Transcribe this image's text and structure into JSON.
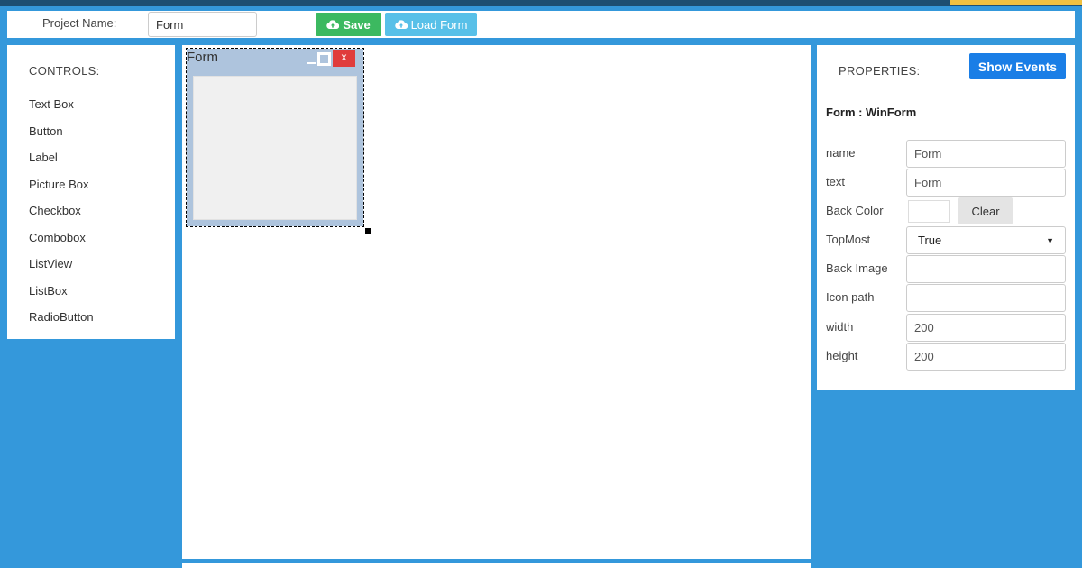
{
  "toolbar": {
    "project_name_label": "Project Name:",
    "project_name_value": "Form",
    "save_label": "Save",
    "load_label": "Load Form",
    "save_color": "#3cb960",
    "load_color": "#58c0e8"
  },
  "controls": {
    "title": "CONTROLS:",
    "items": [
      "Text Box",
      "Button",
      "Label",
      "Picture Box",
      "Checkbox",
      "Combobox",
      "ListView",
      "ListBox",
      "RadioButton"
    ]
  },
  "designer": {
    "form_title": "Form",
    "close_label": "x"
  },
  "properties": {
    "title": "PROPERTIES:",
    "show_events_label": "Show Events",
    "object_type": "Form : WinForm",
    "name_label": "name",
    "name_value": "Form",
    "text_label": "text",
    "text_value": "Form",
    "back_color_label": "Back Color",
    "clear_label": "Clear",
    "topmost_label": "TopMost",
    "topmost_value": "True",
    "back_image_label": "Back Image",
    "back_image_value": "",
    "icon_path_label": "Icon path",
    "icon_path_value": "",
    "width_label": "width",
    "width_value": "200",
    "height_label": "height",
    "height_value": "200"
  },
  "colors": {
    "background": "#3498db",
    "form_titlebar": "#aec4dd",
    "close_button": "#e03c3c",
    "show_events_button": "#1a7ee6"
  },
  "icons": {
    "save": "cloud-upload-icon",
    "load": "cloud-upload-icon",
    "select_caret": "caret-down-icon"
  }
}
